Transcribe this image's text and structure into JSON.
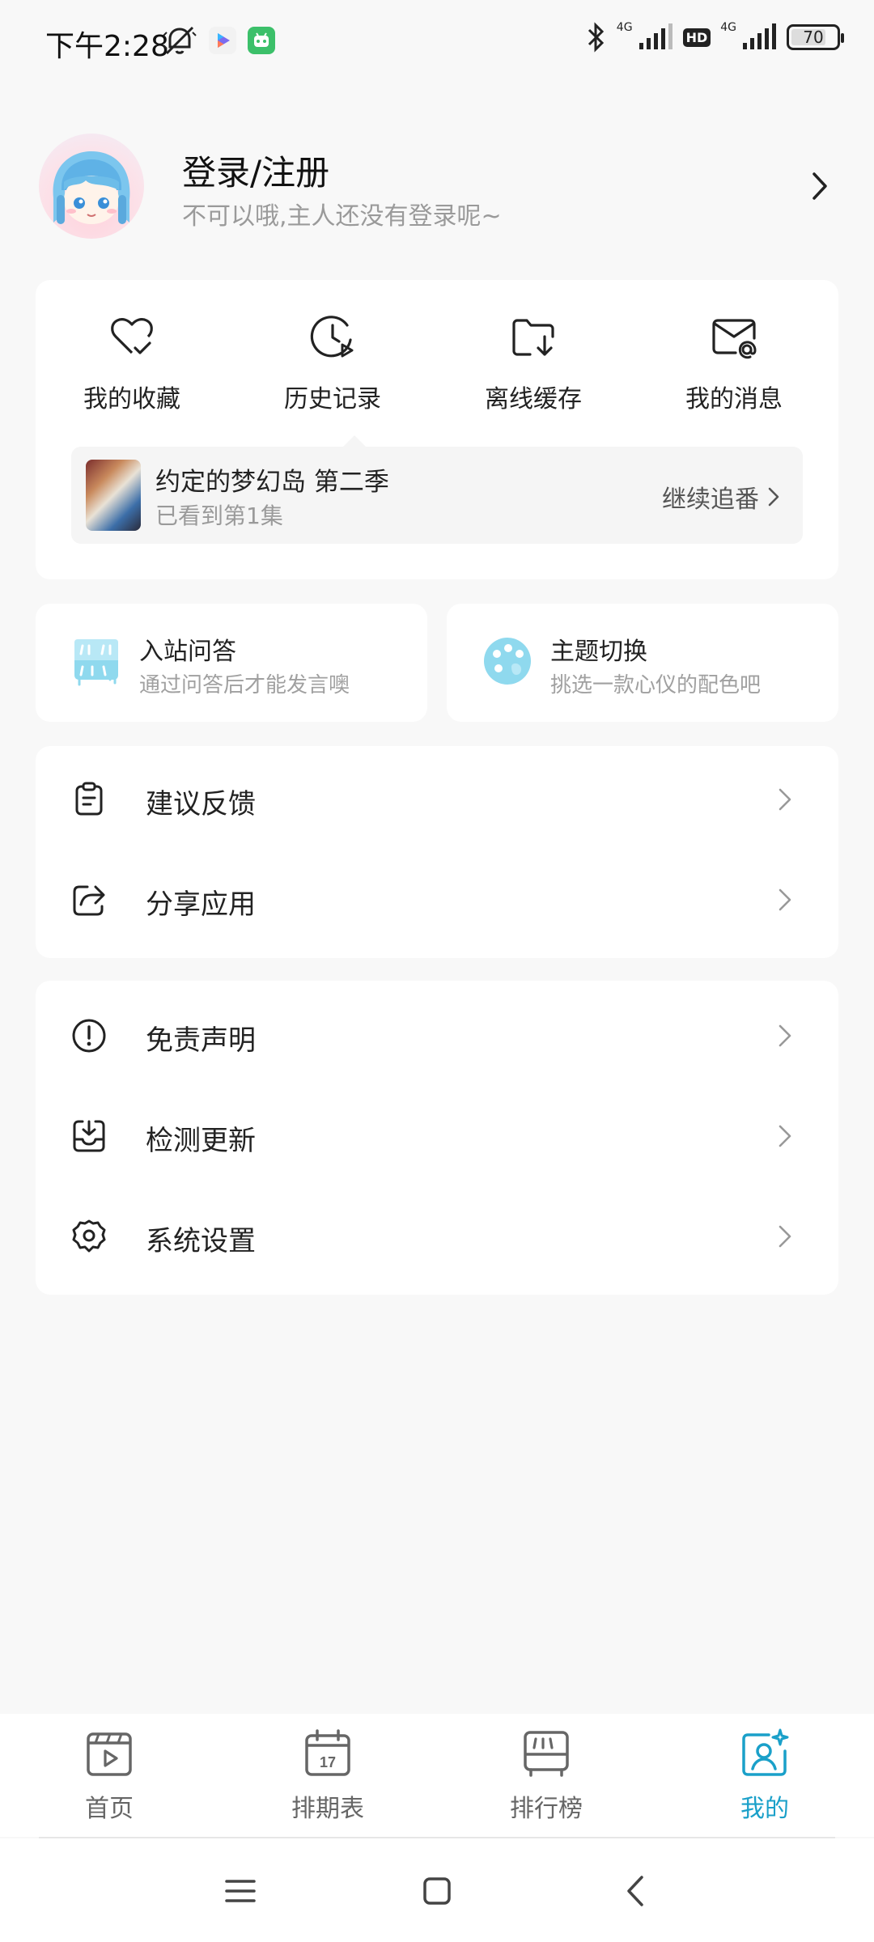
{
  "status_bar": {
    "time": "下午2:28",
    "net1": "4G",
    "hd": "HD",
    "net2": "4G",
    "battery": "70",
    "icons": [
      "mute-bell-icon",
      "video-app-icon",
      "android-app-icon",
      "bluetooth-icon",
      "signal-icon",
      "battery-icon"
    ]
  },
  "profile": {
    "title": "登录/注册",
    "subtitle": "不可以哦,主人还没有登录呢~"
  },
  "quick_actions": [
    {
      "label": "我的收藏",
      "icon": "heart-check-icon"
    },
    {
      "label": "历史记录",
      "icon": "clock-play-icon"
    },
    {
      "label": "离线缓存",
      "icon": "folder-download-icon"
    },
    {
      "label": "我的消息",
      "icon": "mail-at-icon"
    }
  ],
  "continue_watching": {
    "title": "约定的梦幻岛 第二季",
    "progress": "已看到第1集",
    "action": "继续追番"
  },
  "feature_cards": [
    {
      "title": "入站问答",
      "subtitle": "通过问答后才能发言噢",
      "icon": "quiz-icon"
    },
    {
      "title": "主题切换",
      "subtitle": "挑选一款心仪的配色吧",
      "icon": "palette-icon"
    }
  ],
  "menu_group_1": [
    {
      "label": "建议反馈",
      "icon": "clipboard-icon"
    },
    {
      "label": "分享应用",
      "icon": "share-icon"
    }
  ],
  "menu_group_2": [
    {
      "label": "免责声明",
      "icon": "alert-circle-icon"
    },
    {
      "label": "检测更新",
      "icon": "download-tray-icon"
    },
    {
      "label": "系统设置",
      "icon": "gear-icon"
    }
  ],
  "bottom_nav": [
    {
      "label": "首页",
      "icon": "home-play-icon",
      "active": false
    },
    {
      "label": "排期表",
      "icon": "calendar-icon",
      "active": false
    },
    {
      "label": "排行榜",
      "icon": "ranking-icon",
      "active": false
    },
    {
      "label": "我的",
      "icon": "profile-sparkle-icon",
      "active": true
    }
  ],
  "calendar_day": "17",
  "colors": {
    "accent": "#1aa0c9",
    "background": "#f8f8f8",
    "card": "#ffffff",
    "muted_text": "#9a9a9a",
    "light_blue_icon": "#8fd9ee"
  }
}
